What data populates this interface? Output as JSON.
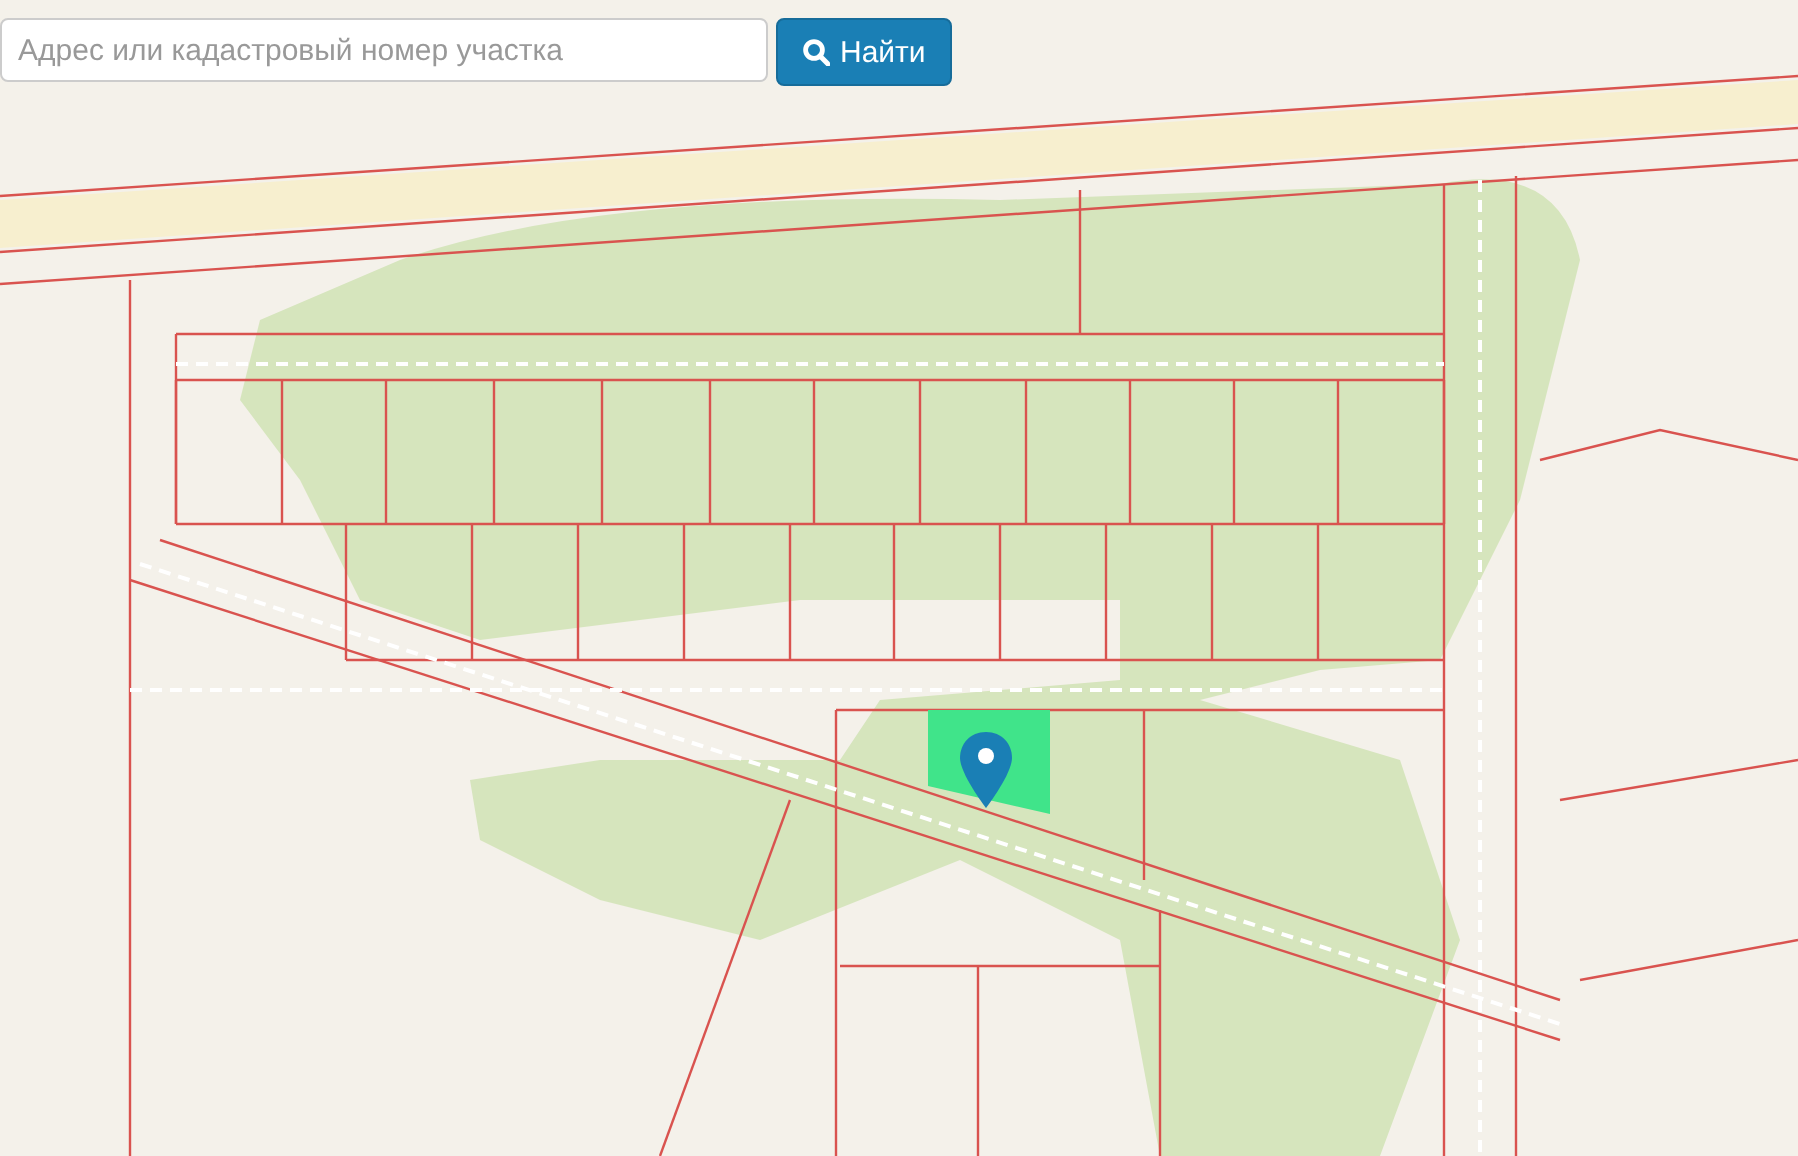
{
  "search": {
    "placeholder": "Адрес или кадастровый номер участка",
    "button": "Найти"
  }
}
